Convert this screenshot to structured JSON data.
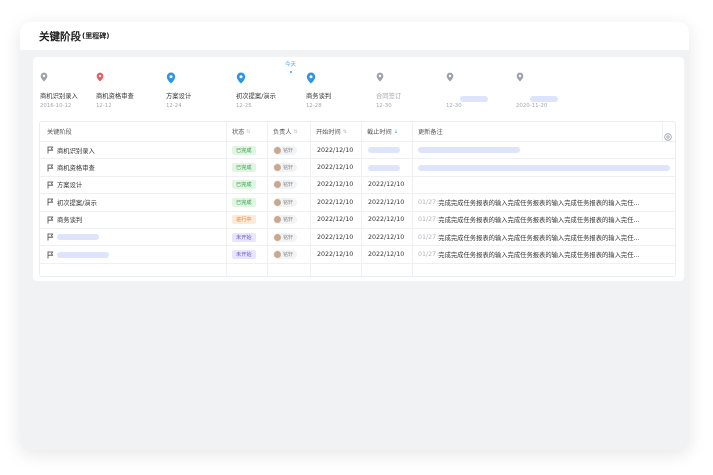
{
  "header": {
    "title": "关键阶段",
    "subtitle": "(里程碑)"
  },
  "colors": {
    "accent": "#3a9ff0",
    "done": "#2f9a46",
    "progress": "#d9822b",
    "todo": "#6a58c9",
    "placeholder": "#dde4fb"
  },
  "timeline": {
    "today_label": "今天",
    "milestones": [
      {
        "label": "商机识别录入",
        "date": "2016-10-12",
        "icon": "pin-gray-icon"
      },
      {
        "label": "商机资格审查",
        "date": "12-12",
        "icon": "pin-red-icon"
      },
      {
        "label": "方案设计",
        "date": "12-24",
        "icon": "pin-blue-icon"
      },
      {
        "label": "初次提案/演示",
        "date": "12-25",
        "icon": "pin-blue-icon"
      },
      {
        "label": "商务谈判",
        "date": "12-28",
        "icon": "pin-blue-icon"
      },
      {
        "label": "合同签订",
        "date": "12-30",
        "icon": "pin-gray-icon"
      },
      {
        "label": "",
        "date": "12-30",
        "icon": "pin-gray-icon"
      },
      {
        "label": "",
        "date": "2020-11-20",
        "icon": "pin-gray-icon"
      }
    ]
  },
  "table": {
    "columns": [
      "关键阶段",
      "状态",
      "负责人",
      "开始时间",
      "截止时间",
      "更新备注"
    ],
    "rows": [
      {
        "stage": "商机识别录入",
        "status": "已完成",
        "owner": "铭轩",
        "start": "2022/12/10",
        "end": "",
        "note_time": "",
        "note": ""
      },
      {
        "stage": "商机资格审查",
        "status": "已完成",
        "owner": "铭轩",
        "start": "2022/12/10",
        "end": "",
        "note_time": "",
        "note": ""
      },
      {
        "stage": "方案设计",
        "status": "已完成",
        "owner": "铭轩",
        "start": "2022/12/10",
        "end": "2022/12/10",
        "note_time": "",
        "note": ""
      },
      {
        "stage": "初次提案/演示",
        "status": "已完成",
        "owner": "铭轩",
        "start": "2022/12/10",
        "end": "2022/12/10",
        "note_time": "01/27:",
        "note": "完成完成任务报表的输入完成任务报表的输入完成任务报表的输入完任..."
      },
      {
        "stage": "商务谈判",
        "status": "进行中",
        "owner": "铭轩",
        "start": "2022/12/10",
        "end": "2022/12/10",
        "note_time": "01/27:",
        "note": "完成完成任务报表的输入完成任务报表的输入完成任务报表的输入完任..."
      },
      {
        "stage": "",
        "status": "未开始",
        "owner": "铭轩",
        "start": "2022/12/10",
        "end": "2022/12/10",
        "note_time": "01/27:",
        "note": "完成完成任务报表的输入完成任务报表的输入完成任务报表的输入完任..."
      },
      {
        "stage": "",
        "status": "未开始",
        "owner": "铭轩",
        "start": "2022/12/10",
        "end": "2022/12/10",
        "note_time": "01/27:",
        "note": "完成完成任务报表的输入完成任务报表的输入完成任务报表的输入完任..."
      }
    ]
  }
}
